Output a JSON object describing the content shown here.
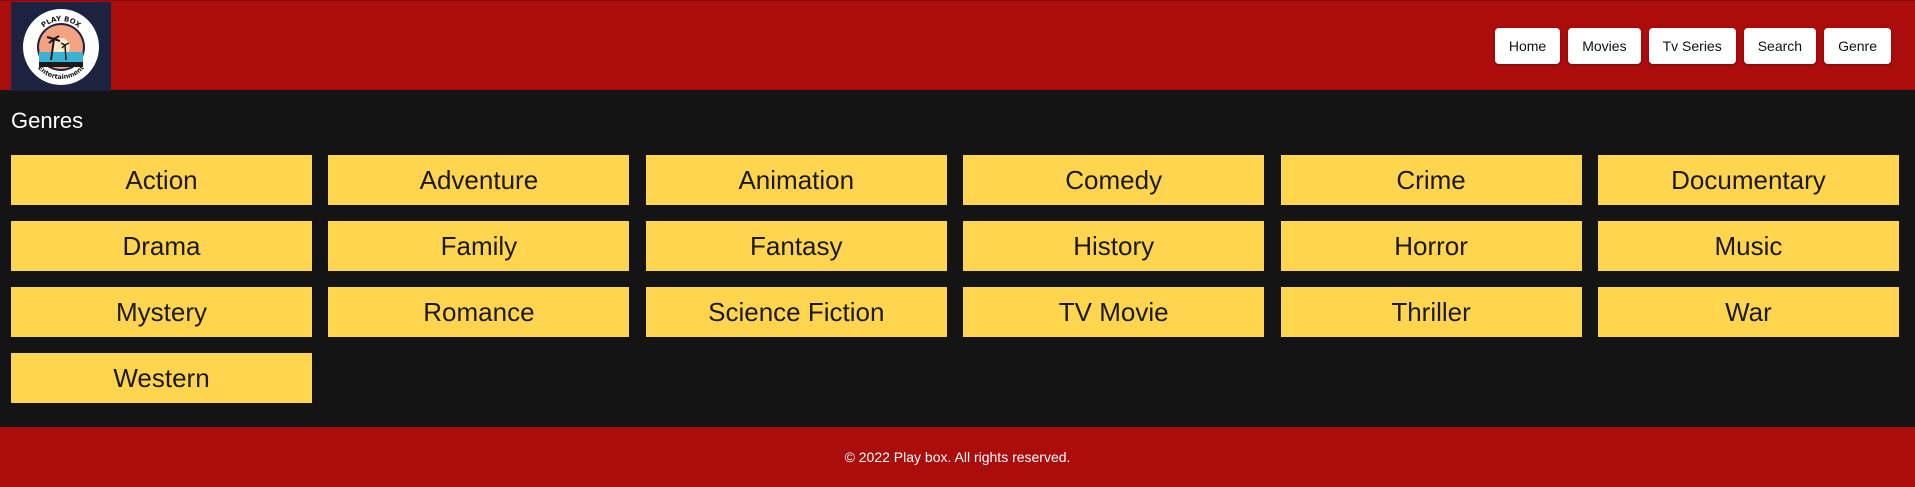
{
  "header": {
    "logo": {
      "top_text": "PLAY BOX",
      "bottom_text": "Entertainment",
      "colors": {
        "badge": "#ffffff",
        "circle_bg": "#f4a382",
        "water": "#3bb3d6"
      }
    },
    "nav": [
      {
        "label": "Home"
      },
      {
        "label": "Movies"
      },
      {
        "label": "Tv Series"
      },
      {
        "label": "Search"
      },
      {
        "label": "Genre"
      }
    ],
    "background_color": "#ab0c0c"
  },
  "main": {
    "title": "Genres",
    "genres": [
      "Action",
      "Adventure",
      "Animation",
      "Comedy",
      "Crime",
      "Documentary",
      "Drama",
      "Family",
      "Fantasy",
      "History",
      "Horror",
      "Music",
      "Mystery",
      "Romance",
      "Science Fiction",
      "TV Movie",
      "Thriller",
      "War",
      "Western"
    ],
    "button_color": "#ffd54f"
  },
  "footer": {
    "text": "© 2022 Play box. All rights reserved."
  }
}
